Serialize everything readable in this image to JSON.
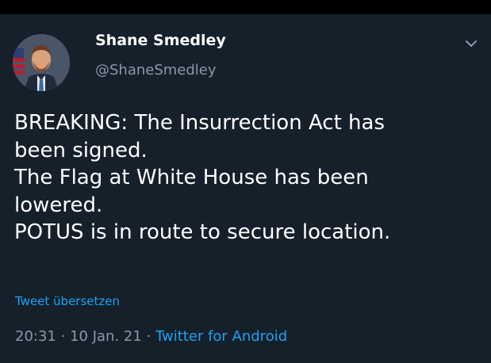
{
  "tweet": {
    "author": {
      "name": "Shane Smedley",
      "handle": "@ShaneSmedley",
      "avatar_icon": "profile-photo-icon"
    },
    "menu_icon": "chevron-down-icon",
    "text_lines": [
      "BREAKING: The Insurrection Act has",
      "been signed.",
      "The Flag at White House has been",
      "lowered.",
      "POTUS is in route to secure location."
    ],
    "translate_label": "Tweet übersetzen",
    "time": "20:31",
    "separator": "·",
    "date": "10 Jan. 21",
    "source": "Twitter for Android"
  },
  "colors": {
    "background": "#15202b",
    "text": "#ffffff",
    "secondary": "#8899a6",
    "accent": "#1da1f2"
  }
}
